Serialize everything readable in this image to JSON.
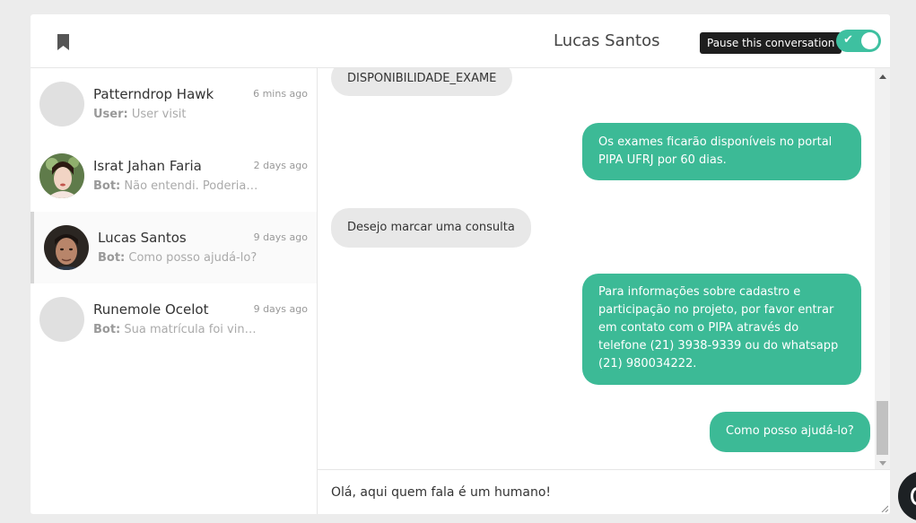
{
  "header": {
    "title": "Lucas Santos",
    "pause_tooltip": "Pause this conversation",
    "pause_toggle_on": true,
    "bookmark_icon": "bookmark-icon"
  },
  "conversations": [
    {
      "name": "Patterndrop Hawk",
      "time": "6 mins ago",
      "sender": "User:",
      "preview": "User visit",
      "avatar": "placeholder"
    },
    {
      "name": "Israt Jahan Faria",
      "time": "2 days ago",
      "sender": "Bot:",
      "preview": "Não entendi. Poderia me…",
      "avatar": "photo"
    },
    {
      "name": "Lucas Santos",
      "time": "9 days ago",
      "sender": "Bot:",
      "preview": "Como posso ajudá-lo?",
      "avatar": "photo",
      "active": true
    },
    {
      "name": "Runemole Ocelot",
      "time": "9 days ago",
      "sender": "Bot:",
      "preview": "Sua matrícula foi vincul…",
      "avatar": "placeholder"
    }
  ],
  "messages": [
    {
      "direction": "incoming",
      "text": "DISPONIBILIDADE_EXAME"
    },
    {
      "direction": "outgoing",
      "text": "Os exames ficarão disponíveis no portal PIPA UFRJ por 60 dias."
    },
    {
      "direction": "incoming",
      "text": "Desejo marcar uma consulta"
    },
    {
      "direction": "outgoing",
      "text": "Para informações sobre cadastro e participação no projeto, por favor entrar em contato com o PIPA através do telefone (21) 3938-9339 ou do whatsapp (21) 980034222."
    },
    {
      "direction": "outgoing",
      "text": "Como posso ajudá-lo?"
    }
  ],
  "composer": {
    "value": "Olá, aqui quem fala é um humano!"
  },
  "colors": {
    "accent": "#3cba96",
    "toggle": "#3ec0a0",
    "incoming_bubble": "#e8e8e8",
    "tooltip_bg": "#1e1e1e"
  }
}
